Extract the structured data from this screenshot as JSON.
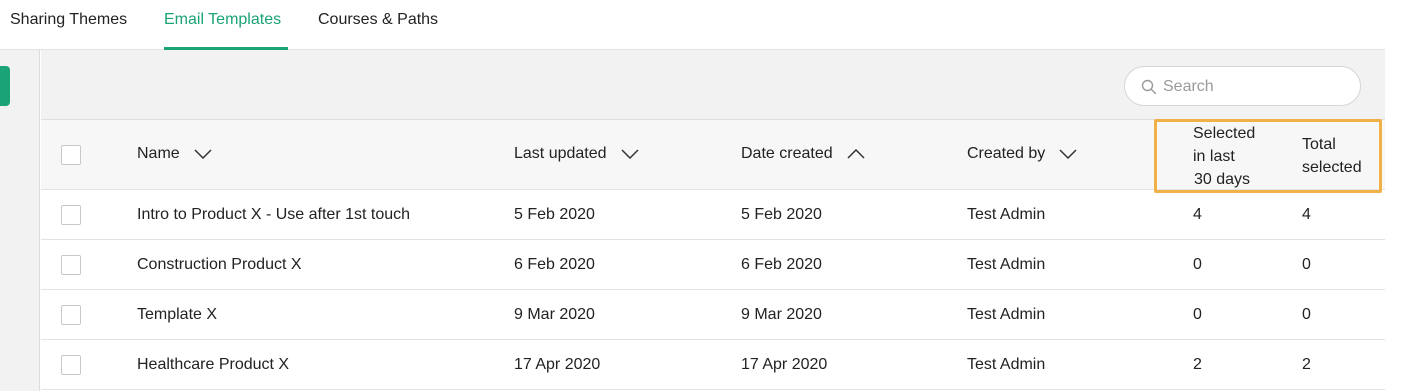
{
  "tabs": [
    {
      "label": "Sharing Themes",
      "active": false
    },
    {
      "label": "Email Templates",
      "active": true
    },
    {
      "label": "Courses & Paths",
      "active": false
    }
  ],
  "colors": {
    "accent": "#1aa377",
    "highlight": "#f0b248"
  },
  "search": {
    "placeholder": "Search",
    "value": "",
    "icon": "search-icon"
  },
  "table": {
    "headers": {
      "name": "Name",
      "last_updated": "Last updated",
      "date_created": "Date created",
      "created_by": "Created by",
      "selected_30_line1": "Selected",
      "selected_30_line2": "in last",
      "selected_30_line3": "30 days",
      "total_line1": "Total",
      "total_line2": "selected"
    },
    "sort": {
      "name": "desc",
      "last_updated": "desc",
      "date_created": "asc",
      "created_by": "desc"
    },
    "rows": [
      {
        "name": "Intro to Product X - Use after 1st touch",
        "last_updated": "5 Feb 2020",
        "date_created": "5 Feb 2020",
        "created_by": "Test Admin",
        "selected_30": "4",
        "total": "4"
      },
      {
        "name": "Construction Product X",
        "last_updated": "6 Feb 2020",
        "date_created": "6 Feb 2020",
        "created_by": "Test Admin",
        "selected_30": "0",
        "total": "0"
      },
      {
        "name": "Template X",
        "last_updated": "9 Mar 2020",
        "date_created": "9 Mar 2020",
        "created_by": "Test Admin",
        "selected_30": "0",
        "total": "0"
      },
      {
        "name": "Healthcare Product X",
        "last_updated": "17 Apr 2020",
        "date_created": "17 Apr 2020",
        "created_by": "Test Admin",
        "selected_30": "2",
        "total": "2"
      }
    ]
  }
}
